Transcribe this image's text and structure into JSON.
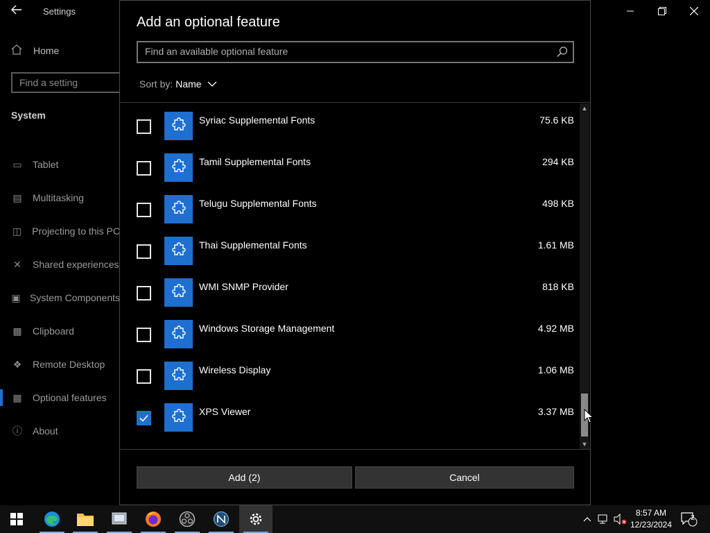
{
  "settings_window": {
    "title": "Settings",
    "home_label": "Home",
    "search_placeholder": "Find a setting",
    "section_label": "System",
    "nav_items": [
      {
        "label": "Tablet",
        "icon": "tablet-icon"
      },
      {
        "label": "Multitasking",
        "icon": "multitasking-icon"
      },
      {
        "label": "Projecting to this PC",
        "icon": "projecting-icon"
      },
      {
        "label": "Shared experiences",
        "icon": "shared-experiences-icon"
      },
      {
        "label": "System Components",
        "icon": "system-components-icon"
      },
      {
        "label": "Clipboard",
        "icon": "clipboard-icon"
      },
      {
        "label": "Remote Desktop",
        "icon": "remote-desktop-icon"
      },
      {
        "label": "Optional features",
        "icon": "optional-features-icon",
        "selected": true
      },
      {
        "label": "About",
        "icon": "info-icon"
      }
    ]
  },
  "dialog": {
    "title": "Add an optional feature",
    "search_placeholder": "Find an available optional feature",
    "sort_label": "Sort by:",
    "sort_value": "Name",
    "features": [
      {
        "name": "Syriac Supplemental Fonts",
        "size": "75.6 KB",
        "checked": false
      },
      {
        "name": "Tamil Supplemental Fonts",
        "size": "294 KB",
        "checked": false
      },
      {
        "name": "Telugu Supplemental Fonts",
        "size": "498 KB",
        "checked": false
      },
      {
        "name": "Thai Supplemental Fonts",
        "size": "1.61 MB",
        "checked": false
      },
      {
        "name": "WMI SNMP Provider",
        "size": "818 KB",
        "checked": false
      },
      {
        "name": "Windows Storage Management",
        "size": "4.92 MB",
        "checked": false
      },
      {
        "name": "Wireless Display",
        "size": "1.06 MB",
        "checked": false
      },
      {
        "name": "XPS Viewer",
        "size": "3.37 MB",
        "checked": true
      }
    ],
    "add_button": "Add (2)",
    "cancel_button": "Cancel"
  },
  "taskbar": {
    "apps": [
      "start-icon",
      "edge-icon",
      "file-explorer-icon",
      "app-icon",
      "firefox-icon",
      "obs-icon",
      "app-icon",
      "settings-icon"
    ],
    "time": "8:57 AM",
    "date": "12/23/2024",
    "notification_count": "2"
  },
  "colors": {
    "accent": "#1e6fd0",
    "background": "#000000",
    "button": "#333333"
  }
}
